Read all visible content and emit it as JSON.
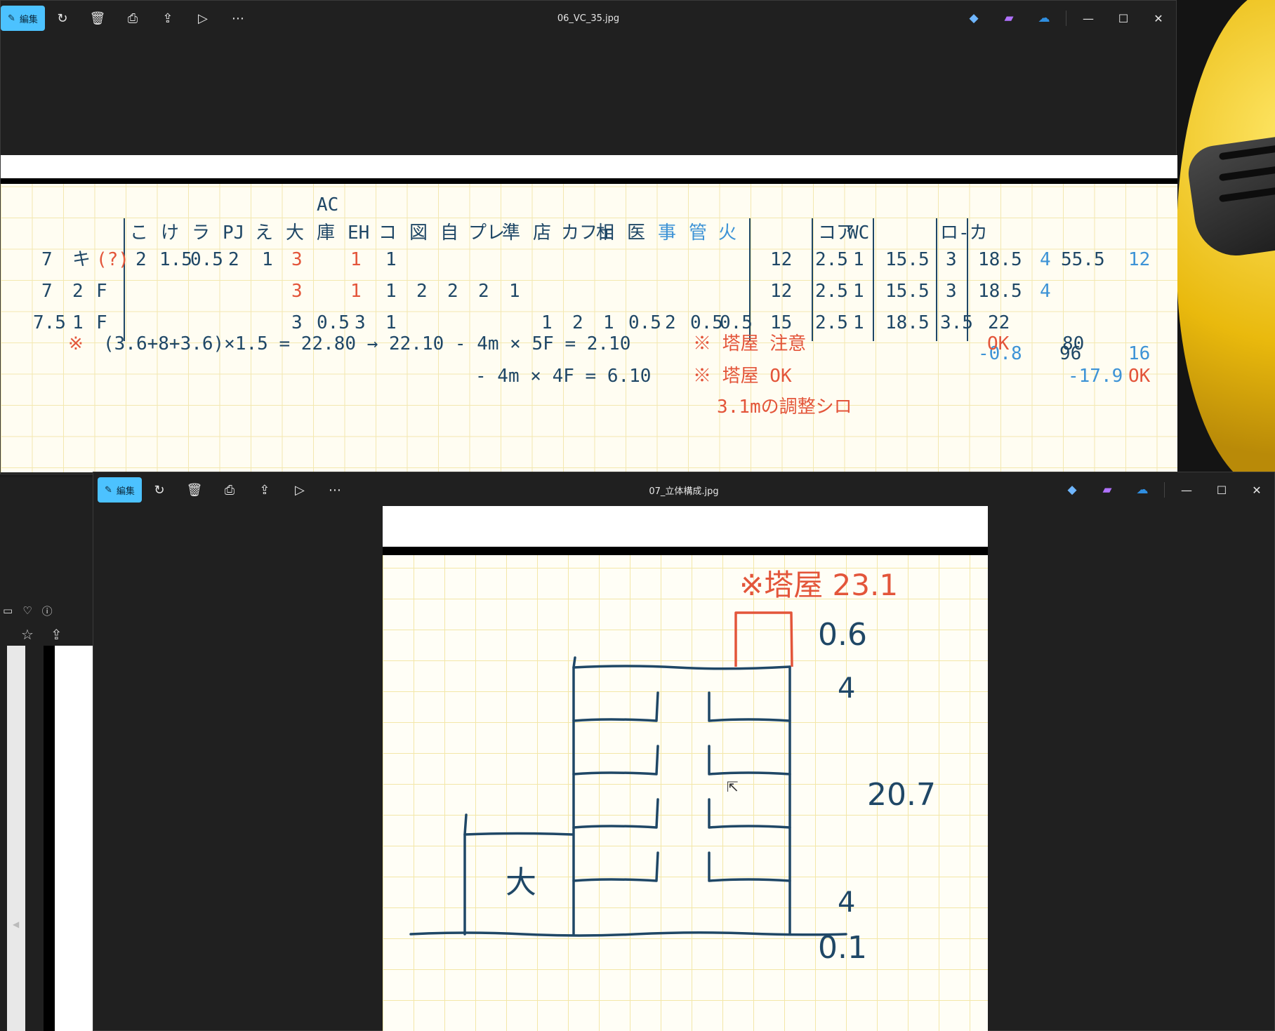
{
  "window1": {
    "title": "06_VC_35.jpg",
    "edit_label": "編集",
    "table": {
      "header_top": "AC",
      "headers_main": [
        "こ",
        "け",
        "ラ",
        "PJ",
        "え",
        "大",
        "庫",
        "EH",
        "コ",
        "図",
        "自",
        "プレ",
        "準",
        "店",
        "カフェ",
        "相",
        "医",
        "事",
        "管",
        "火"
      ],
      "headers_mid": [
        "コア",
        "WC"
      ],
      "header_right": "ロ-カ",
      "row1_prefix": [
        "7",
        "キ",
        "(?)"
      ],
      "row1_values": [
        "2",
        "1.5",
        "0.5",
        "2",
        "1",
        "3",
        "",
        "1",
        "1"
      ],
      "row1_sum": "12",
      "row1_core": [
        "2.5",
        "1"
      ],
      "row1_sub": "15.5",
      "row1_loka": "3",
      "row1_total": "18.5",
      "row1_extra": [
        "4",
        "55.5",
        "12"
      ],
      "row2_prefix": [
        "7",
        "2",
        "F"
      ],
      "row2_values": [
        "3",
        "1",
        "1",
        "2",
        "2",
        "2",
        "1"
      ],
      "row2_sum": "12",
      "row2_core": [
        "2.5",
        "1"
      ],
      "row2_sub": "15.5",
      "row2_loka": "3",
      "row2_total": "18.5",
      "row2_extra": [
        "4"
      ],
      "row3_prefix": [
        "7.5",
        "1",
        "F"
      ],
      "row3_values_a": [
        "3",
        "0.5",
        "3",
        "1"
      ],
      "row3_values_b": [
        "1",
        "2",
        "1",
        "0.5",
        "2",
        "0.5",
        "0.5"
      ],
      "row3_sum": "15",
      "row3_core": [
        "2.5",
        "1"
      ],
      "row3_sub": "18.5",
      "row3_loka": "3.5",
      "row3_total": "22",
      "row4": [
        "-0.8",
        "96",
        "16"
      ],
      "formula1_mark": "※",
      "formula1": "(3.6+8+3.6)×1.5 = 22.80 → 22.10 - 4m × 5F = 2.10",
      "formula1_note": "※ 塔屋 注意",
      "formula1_right": [
        "OK",
        "80"
      ],
      "formula2": "- 4m × 4F = 6.10",
      "formula2_note": "※ 塔屋 OK",
      "formula2_right": [
        "-17.9",
        "OK"
      ],
      "footnote": "3.1mの調整シロ"
    }
  },
  "window2": {
    "title": "07_立体構成.jpg",
    "edit_label": "編集",
    "drawing": {
      "penthouse_label": "※塔屋 23.1",
      "labels": [
        "0.6",
        "4",
        "20.7",
        "4",
        "0.1"
      ],
      "block_label": "大"
    }
  },
  "colors": {
    "accent": "#4cc2ff",
    "ink_navy": "#1f4766",
    "ink_red": "#e3553a",
    "ink_blue": "#3d93d6",
    "grid": "#f3e8b0"
  }
}
